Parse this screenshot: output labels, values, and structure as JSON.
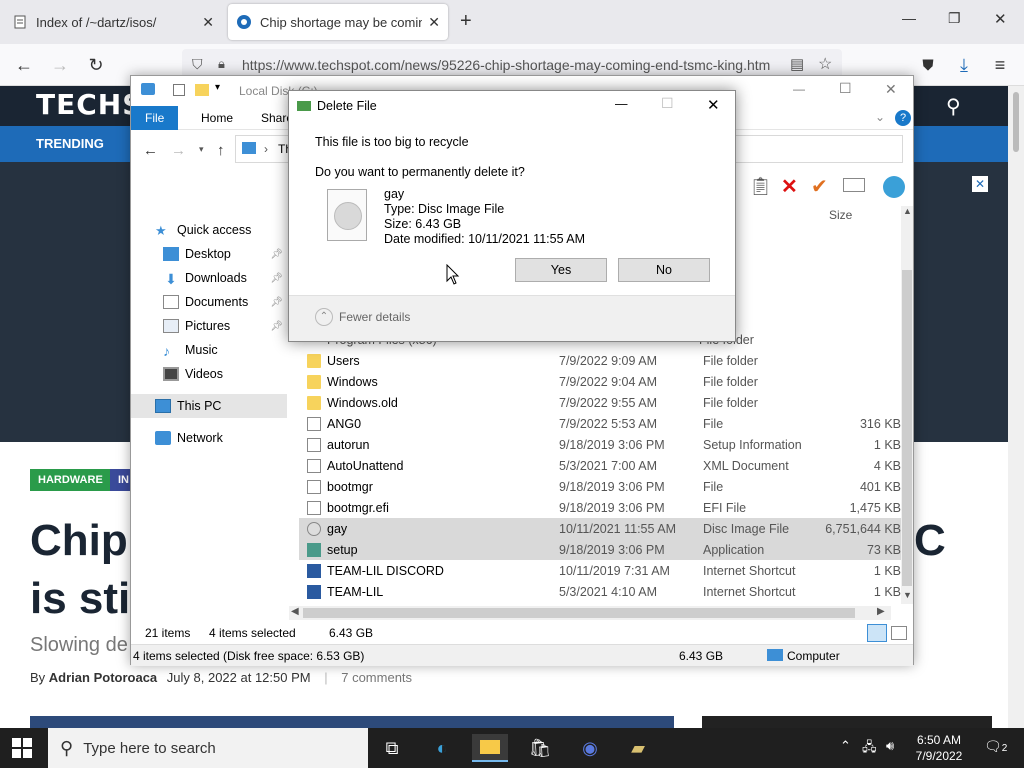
{
  "browser": {
    "tabs": [
      {
        "title": "Index of /~dartz/isos/"
      },
      {
        "title": "Chip shortage may be coming"
      }
    ],
    "url": "https://www.techspot.com/news/95226-chip-shortage-may-coming-end-tsmc-king.htm"
  },
  "page": {
    "logo": "TECHS",
    "trending": "TRENDING",
    "tags": [
      "HARDWARE",
      "IN"
    ],
    "headline_line1": "Chip",
    "headline_line2": "is stil",
    "headline_right": "C",
    "subheadline": "Slowing de",
    "byline_prefix": "By",
    "author": "Adrian Potoroaca",
    "date": "July 8, 2022 at 12:50 PM",
    "comments": "7 comments"
  },
  "explorer": {
    "title": "Local Disk (C:)",
    "ribbon_tabs": [
      "File",
      "Home",
      "Share"
    ],
    "address_fragment": "Th",
    "size_header": "Size",
    "nav": {
      "quick_access": "Quick access",
      "items": [
        "Desktop",
        "Downloads",
        "Documents",
        "Pictures",
        "Music",
        "Videos"
      ],
      "this_pc": "This PC",
      "network": "Network"
    },
    "partial_rows": [
      {
        "type": "older"
      },
      {
        "type": "older"
      },
      {
        "type": "older"
      },
      {
        "type": "older"
      },
      {
        "type": "older"
      },
      {
        "name": "Program Files (x86)",
        "type": "File folder"
      }
    ],
    "files": [
      {
        "name": "Users",
        "date": "7/9/2022 9:09 AM",
        "type": "File folder",
        "size": "",
        "icon": "folder"
      },
      {
        "name": "Windows",
        "date": "7/9/2022 9:04 AM",
        "type": "File folder",
        "size": "",
        "icon": "folder"
      },
      {
        "name": "Windows.old",
        "date": "7/9/2022 9:55 AM",
        "type": "File folder",
        "size": "",
        "icon": "folder"
      },
      {
        "name": "ANG0",
        "date": "7/9/2022 5:53 AM",
        "type": "File",
        "size": "316 KB",
        "icon": "doc"
      },
      {
        "name": "autorun",
        "date": "9/18/2019 3:06 PM",
        "type": "Setup Information",
        "size": "1 KB",
        "icon": "doc"
      },
      {
        "name": "AutoUnattend",
        "date": "5/3/2021 7:00 AM",
        "type": "XML Document",
        "size": "4 KB",
        "icon": "doc"
      },
      {
        "name": "bootmgr",
        "date": "9/18/2019 3:06 PM",
        "type": "File",
        "size": "401 KB",
        "icon": "doc"
      },
      {
        "name": "bootmgr.efi",
        "date": "9/18/2019 3:06 PM",
        "type": "EFI File",
        "size": "1,475 KB",
        "icon": "doc"
      },
      {
        "name": "gay",
        "date": "10/11/2021 11:55 AM",
        "type": "Disc Image File",
        "size": "6,751,644 KB",
        "icon": "disc",
        "selected": true
      },
      {
        "name": "setup",
        "date": "9/18/2019 3:06 PM",
        "type": "Application",
        "size": "73 KB",
        "icon": "app",
        "selected": true
      },
      {
        "name": "TEAM-LIL DISCORD",
        "date": "10/11/2019 7:31 AM",
        "type": "Internet Shortcut",
        "size": "1 KB",
        "icon": "link"
      },
      {
        "name": "TEAM-LIL",
        "date": "5/3/2021 4:10 AM",
        "type": "Internet Shortcut",
        "size": "1 KB",
        "icon": "link"
      }
    ],
    "status": {
      "items": "21 items",
      "selected": "4 items selected",
      "selected_size": "6.43 GB",
      "disk_status": "4 items selected (Disk free space: 6.53 GB)",
      "size2": "6.43 GB",
      "computer": "Computer"
    }
  },
  "dialog": {
    "title": "Delete File",
    "line1": "This file is too big to recycle",
    "line2": "Do you want to permanently delete it?",
    "file_name": "gay",
    "file_type": "Type: Disc Image File",
    "file_size": "Size: 6.43 GB",
    "file_date": "Date modified: 10/11/2021 11:55 AM",
    "yes": "Yes",
    "no": "No",
    "fewer_details": "Fewer details"
  },
  "taskbar": {
    "search_placeholder": "Type here to search",
    "time": "6:50 AM",
    "date": "7/9/2022",
    "notifications": "2"
  }
}
